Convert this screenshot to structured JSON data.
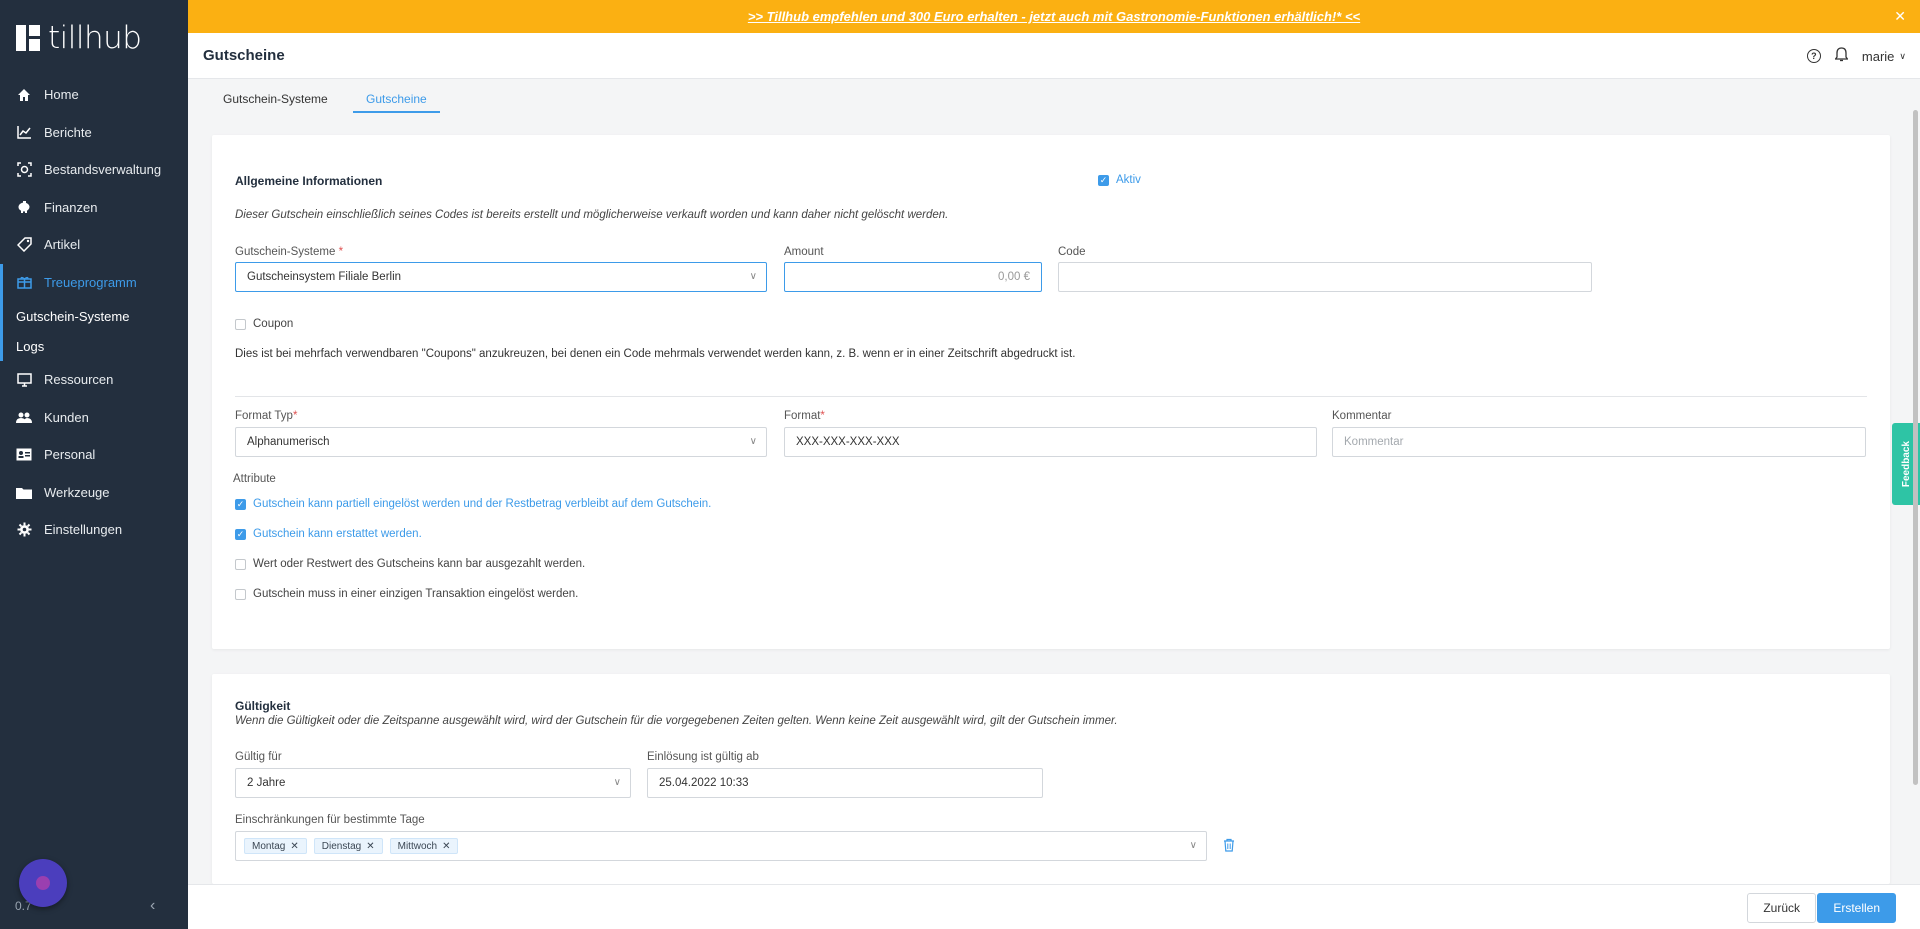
{
  "app": {
    "logo_text": "tillhub",
    "version": "0.7"
  },
  "sidebar": {
    "items": [
      {
        "label": "Home",
        "icon": "home-icon"
      },
      {
        "label": "Berichte",
        "icon": "chart-icon"
      },
      {
        "label": "Bestandsverwaltung",
        "icon": "inventory-icon"
      },
      {
        "label": "Finanzen",
        "icon": "piggy-bank-icon"
      },
      {
        "label": "Artikel",
        "icon": "tag-icon"
      },
      {
        "label": "Treueprogramm",
        "icon": "gift-icon",
        "active": true
      },
      {
        "label": "Ressourcen",
        "icon": "monitor-icon"
      },
      {
        "label": "Kunden",
        "icon": "people-icon"
      },
      {
        "label": "Personal",
        "icon": "id-card-icon"
      },
      {
        "label": "Werkzeuge",
        "icon": "folder-icon"
      },
      {
        "label": "Einstellungen",
        "icon": "gear-icon"
      }
    ],
    "sub_items": [
      {
        "label": "Gutschein-Systeme"
      },
      {
        "label": "Logs"
      }
    ]
  },
  "banner": {
    "text": ">> Tillhub empfehlen und 300 Euro erhalten - jetzt auch mit Gastronomie-Funktionen erhältlich!* <<",
    "color": "#fbb012"
  },
  "header": {
    "title": "Gutscheine",
    "user": "marie"
  },
  "tabs": [
    {
      "label": "Gutschein-Systeme",
      "active": false
    },
    {
      "label": "Gutscheine",
      "active": true
    }
  ],
  "general": {
    "heading": "Allgemeine Informationen",
    "active_label": "Aktiv",
    "active_checked": true,
    "notice": "Dieser Gutschein einschließlich seines Codes ist bereits erstellt und möglicherweise verkauft worden und kann daher nicht gelöscht werden.",
    "system_label": "Gutschein-Systeme",
    "system_value": "Gutscheinsystem Filiale Berlin",
    "amount_label": "Amount",
    "amount_value": "0,00 €",
    "code_label": "Code",
    "code_value": "",
    "coupon_label": "Coupon",
    "coupon_checked": false,
    "coupon_help": "Dies ist bei mehrfach verwendbaren \"Coupons\" anzukreuzen, bei denen ein Code mehrmals verwendet werden kann, z. B. wenn er in einer Zeitschrift abgedruckt ist.",
    "format_type_label": "Format Typ",
    "format_type_value": "Alphanumerisch",
    "format_label": "Format",
    "format_value": "XXX-XXX-XXX-XXX",
    "comment_label": "Kommentar",
    "comment_placeholder": "Kommentar",
    "attribute_label": "Attribute",
    "attributes": [
      {
        "label": "Gutschein kann partiell eingelöst werden und der Restbetrag verbleibt auf dem Gutschein.",
        "checked": true
      },
      {
        "label": "Gutschein kann erstattet werden.",
        "checked": true
      },
      {
        "label": "Wert oder Restwert des Gutscheins kann bar ausgezahlt werden.",
        "checked": false
      },
      {
        "label": "Gutschein muss in einer einzigen Transaktion eingelöst werden.",
        "checked": false
      }
    ]
  },
  "validity": {
    "heading": "Gültigkeit",
    "notice": "Wenn die Gültigkeit oder die Zeitspanne ausgewählt wird, wird der Gutschein für die vorgegebenen Zeiten gelten. Wenn keine Zeit ausgewählt wird, gilt der Gutschein immer.",
    "valid_for_label": "Gültig für",
    "valid_for_value": "2 Jahre",
    "redeem_from_label": "Einlösung ist gültig ab",
    "redeem_from_value": "25.04.2022 10:33",
    "restrictions_label": "Einschränkungen für bestimmte Tage",
    "days": [
      "Montag",
      "Dienstag",
      "Mittwoch"
    ]
  },
  "footer": {
    "back_label": "Zurück",
    "create_label": "Erstellen"
  },
  "feedback_label": "Feedback",
  "colors": {
    "sidebar": "#232f3e",
    "accent": "#3d9be9",
    "banner": "#fbb012",
    "feedback": "#2ec4a5"
  }
}
